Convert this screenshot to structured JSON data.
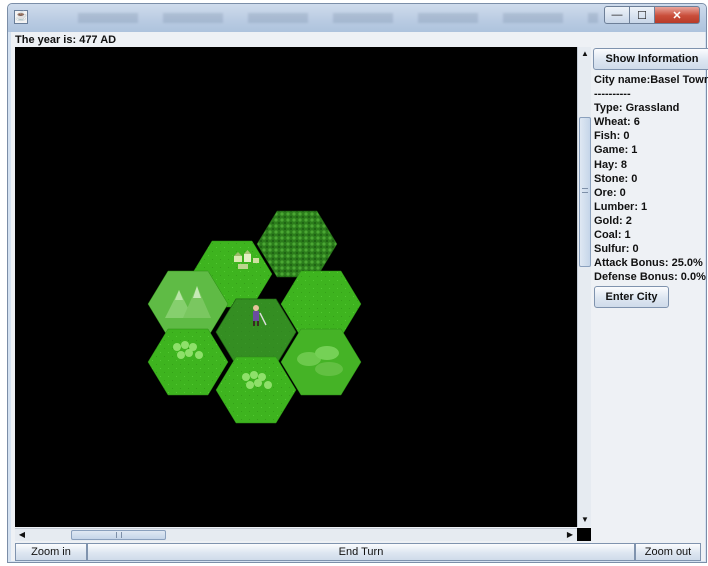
{
  "window": {
    "icon_glyph": "☕",
    "minimize_glyph": "—",
    "maximize_glyph": "☐",
    "close_glyph": "✕"
  },
  "status": {
    "year_text": "The year is: 477 AD"
  },
  "info_panel": {
    "show_info_label": "Show Information",
    "lines": [
      "City name:Basel Town",
      "----------",
      "Type: Grassland",
      "Wheat: 6",
      "Fish: 0",
      "Game: 1",
      "Hay: 8",
      "Stone: 0",
      "Ore: 0",
      "Lumber: 1",
      "Gold: 2",
      "Coal: 1",
      "Sulfur: 0",
      "Attack Bonus: 25.0%",
      "Defense Bonus: 0.0%"
    ],
    "enter_city_label": "Enter City"
  },
  "bottom_bar": {
    "zoom_in_label": "Zoom in",
    "end_turn_label": "End Turn",
    "zoom_out_label": "Zoom out"
  },
  "scrollbars": {
    "up_arrow": "▲",
    "down_arrow": "▼",
    "left_arrow": "◀",
    "right_arrow": "▶"
  },
  "map": {
    "colors": {
      "background": "#000000",
      "grass": "#3fae1f",
      "grass_light": "#4cc22a",
      "forest": "#2e8a1d",
      "mountain": "#6ec05a",
      "city": "#2b6e2a"
    },
    "tiles": [
      {
        "terrain": "forest-dense",
        "icon": "dense-forest-icon"
      },
      {
        "terrain": "hills-town",
        "icon": "town-icon"
      },
      {
        "terrain": "mountains",
        "icon": "mountain-icon"
      },
      {
        "terrain": "city",
        "icon": "unit-icon"
      },
      {
        "terrain": "grassland",
        "icon": "grass-icon"
      },
      {
        "terrain": "trees",
        "icon": "tree-icon"
      },
      {
        "terrain": "trees",
        "icon": "tree-icon"
      },
      {
        "terrain": "hills",
        "icon": "hills-icon"
      }
    ]
  }
}
